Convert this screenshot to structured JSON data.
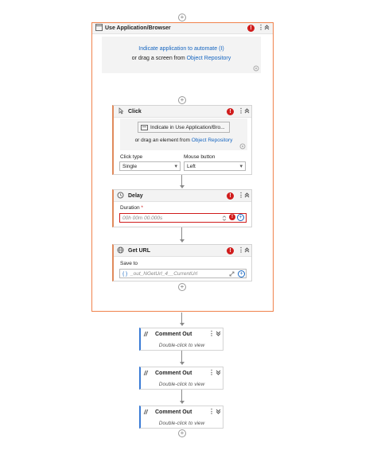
{
  "main_scope": {
    "title": "Use Application/Browser",
    "indicate_link": "Indicate application to automate (I)",
    "or_drag_prefix": "or drag a screen from",
    "object_repository": "Object Repository"
  },
  "click": {
    "title": "Click",
    "indicate_button": "Indicate in Use Application/Bro...",
    "or_drag_prefix": "or drag an element from",
    "object_repository": "Object Repository",
    "click_type_label": "Click type",
    "click_type_value": "Single",
    "mouse_button_label": "Mouse button",
    "mouse_button_value": "Left"
  },
  "delay": {
    "title": "Delay",
    "duration_label": "Duration",
    "required_mark": "*",
    "duration_placeholder": "00h 00m 00.000s"
  },
  "get_url": {
    "title": "Get URL",
    "save_to_label": "Save to",
    "save_to_value": "_out_NGetUrl_4__CurrentUrl",
    "var_icon": "{ }"
  },
  "comments": [
    {
      "title": "Comment Out",
      "hint": "Double-click to view"
    },
    {
      "title": "Comment Out",
      "hint": "Double-click to view"
    },
    {
      "title": "Comment Out",
      "hint": "Double-click to view"
    }
  ],
  "icons": {
    "plus": "+",
    "error": "!",
    "more": "⋮",
    "collapse": "≈",
    "expand": "≫",
    "dropdown": "▾",
    "comment": "//",
    "pencil": "✎"
  },
  "colors": {
    "selection_border": "#f0824c",
    "error_red": "#d01c1c",
    "link_blue": "#1565c0",
    "comment_accent": "#3a7bd5"
  }
}
